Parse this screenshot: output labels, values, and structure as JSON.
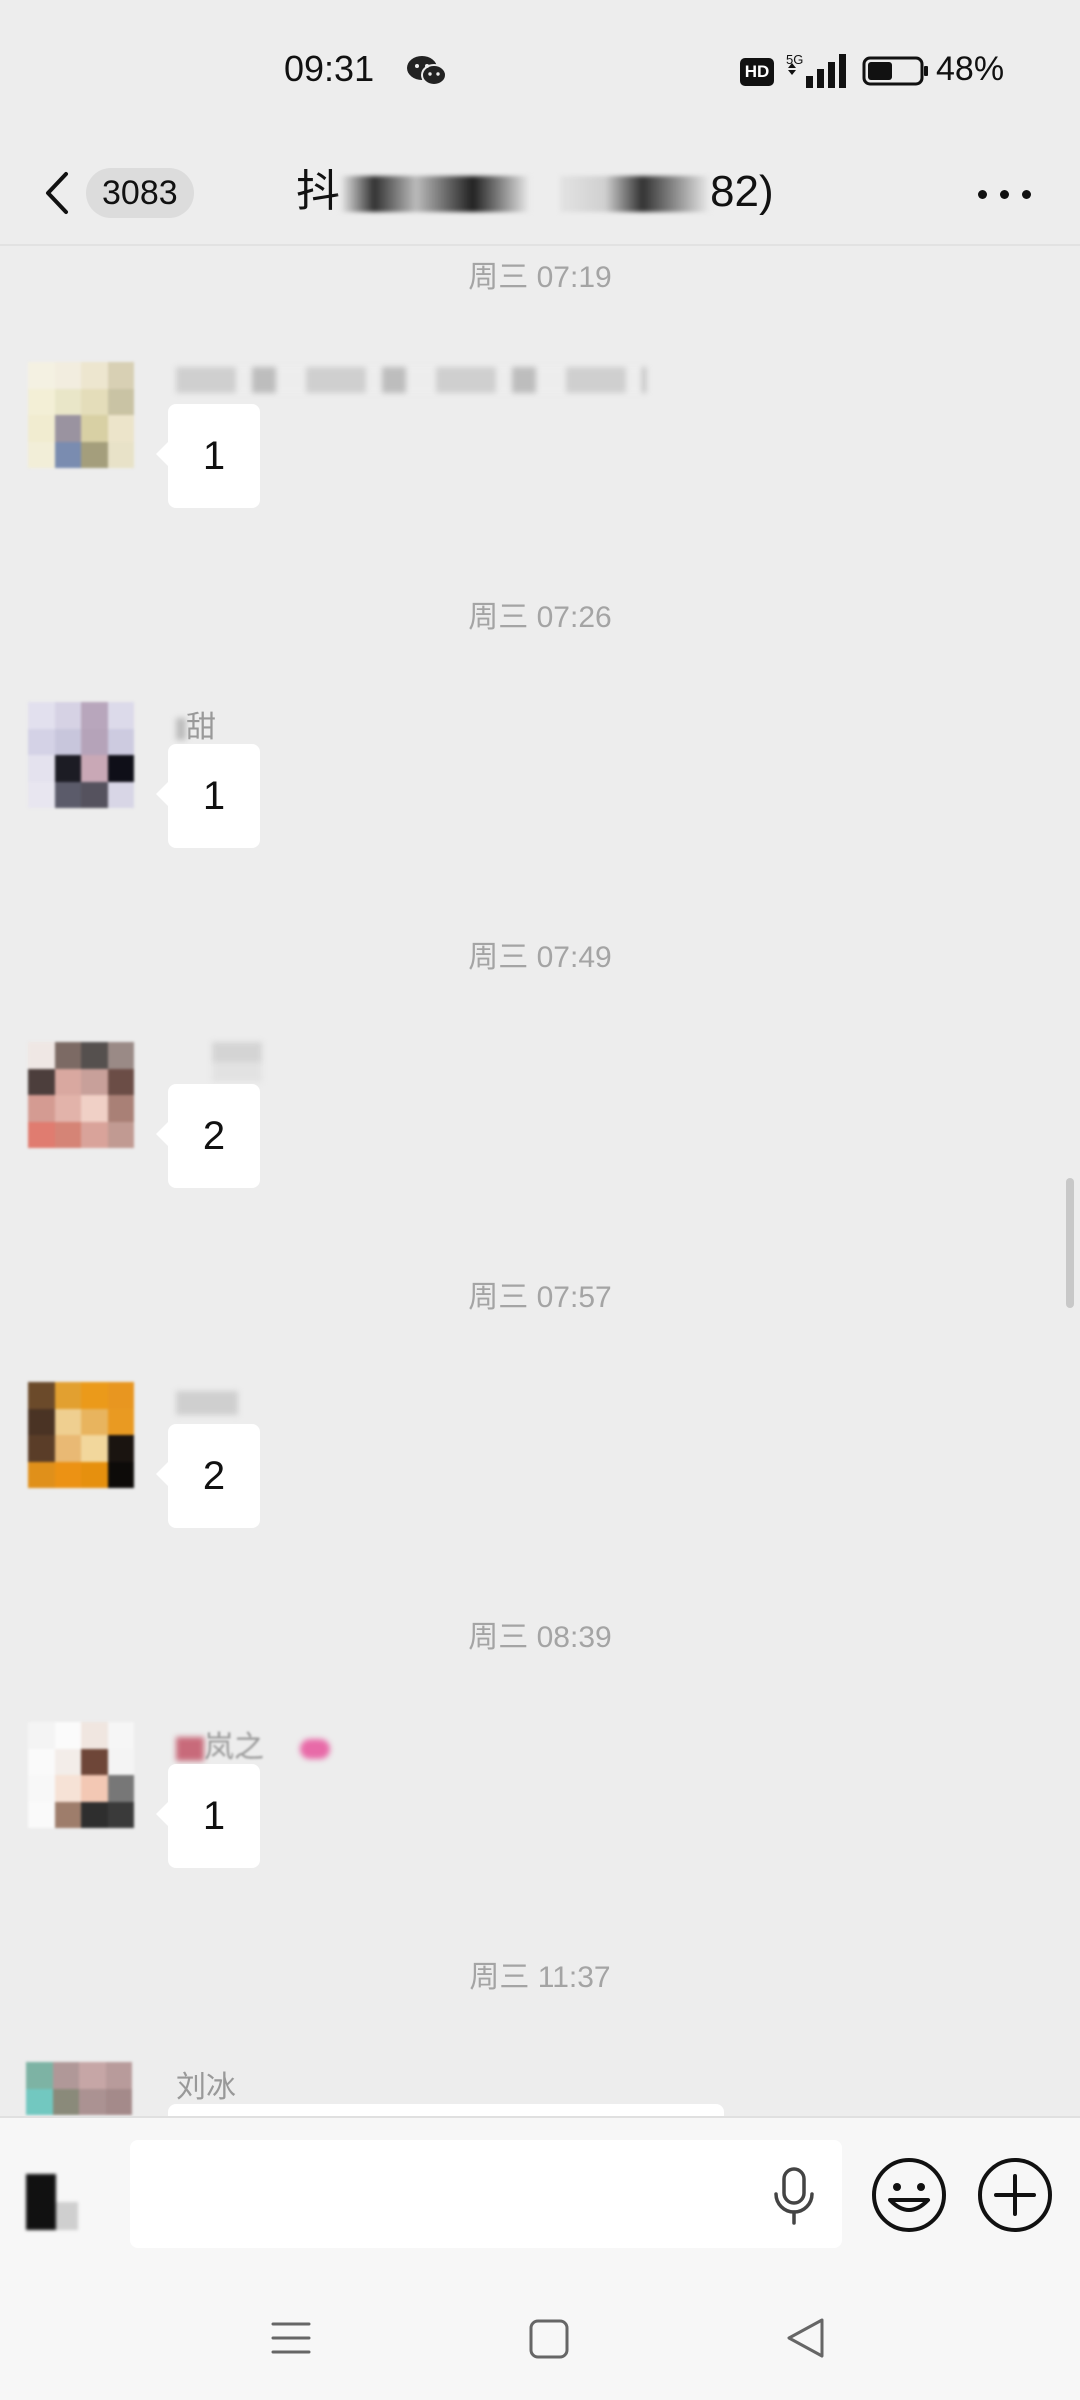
{
  "status_bar": {
    "time": "09:31",
    "hd": "HD",
    "network": "5G",
    "battery": "48%",
    "battery_level": 0.48
  },
  "header": {
    "unread_count": "3083",
    "title_start": "抖",
    "title_end": "82)",
    "back_icon": "chevron-left-icon",
    "more_icon": "more-dots-icon"
  },
  "messages": [
    {
      "timestamp": "周三 07:19",
      "sender": "",
      "text": "1"
    },
    {
      "timestamp": "周三 07:26",
      "sender": "甜",
      "text": "1"
    },
    {
      "timestamp": "周三 07:49",
      "sender": "",
      "text": "2"
    },
    {
      "timestamp": "周三 07:57",
      "sender": "",
      "text": "2"
    },
    {
      "timestamp": "周三 08:39",
      "sender": "岚之",
      "text": "1"
    },
    {
      "timestamp": "周三 11:37",
      "sender": "刘冰",
      "text": ""
    }
  ],
  "input": {
    "value": "",
    "placeholder": "",
    "mic_icon": "microphone-icon",
    "emoji_icon": "smiley-face-icon",
    "plus_icon": "plus-circle-icon"
  },
  "nav": {
    "menu_icon": "menu-lines-icon",
    "home_icon": "square-home-icon",
    "back_icon": "triangle-back-icon"
  },
  "colors": {
    "background": "#ededed",
    "bubble": "#ffffff",
    "timestamp": "#a4a4a4",
    "sender_name": "#999999",
    "bar": "#f7f7f7"
  }
}
